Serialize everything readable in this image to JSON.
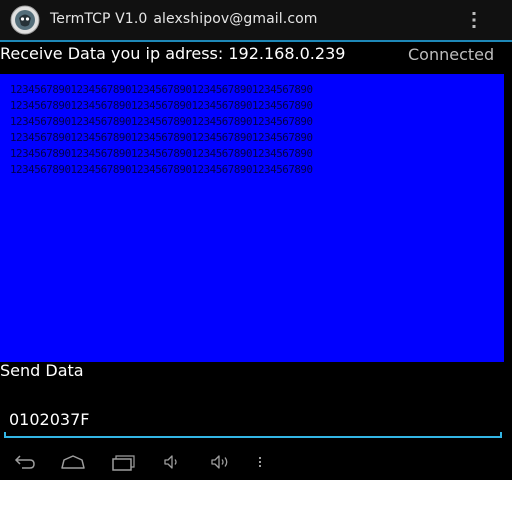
{
  "app": {
    "title": "TermTCP V1.0",
    "email": "alexshipov@gmail.com"
  },
  "receive": {
    "label": "Receive Data  you ip adress: 192.168.0.239",
    "status": "Connected",
    "text": "12345678901234567890123456789012345678901234567890\n12345678901234567890123456789012345678901234567890\n12345678901234567890123456789012345678901234567890\n12345678901234567890123456789012345678901234567890\n12345678901234567890123456789012345678901234567890\n12345678901234567890123456789012345678901234567890"
  },
  "send": {
    "label": "Send Data",
    "value": "0102037F"
  },
  "icons": {
    "app": "app-logo-icon",
    "overflow": "overflow-menu-icon",
    "nav": [
      "back-icon",
      "home-icon",
      "recent-apps-icon",
      "volume-down-icon",
      "volume-up-icon",
      "menu-icon"
    ]
  },
  "colors": {
    "receive_background": "#0000ff",
    "receive_text": "#00004a",
    "accent": "#33b5e5",
    "status": "#bdbdbd"
  }
}
